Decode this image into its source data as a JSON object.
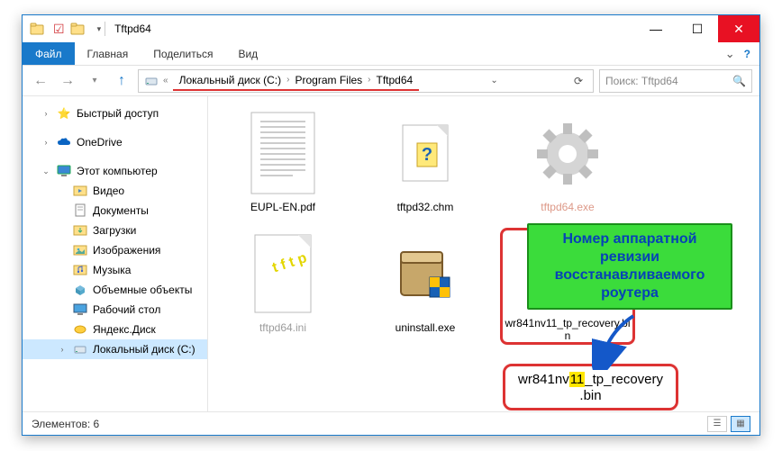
{
  "titlebar": {
    "app_title": "Tftpd64"
  },
  "ribbon": {
    "file": "Файл",
    "home": "Главная",
    "share": "Поделиться",
    "view": "Вид"
  },
  "breadcrumbs": {
    "local_disk": "Локальный диск (C:)",
    "program_files": "Program Files",
    "folder": "Tftpd64"
  },
  "search": {
    "placeholder": "Поиск: Tftpd64"
  },
  "nav": {
    "quick_access": "Быстрый доступ",
    "onedrive": "OneDrive",
    "this_pc": "Этот компьютер",
    "videos": "Видео",
    "documents": "Документы",
    "downloads": "Загрузки",
    "pictures": "Изображения",
    "music": "Музыка",
    "objects3d": "Объемные объекты",
    "desktop": "Рабочий стол",
    "yandex_disk": "Яндекс.Диск",
    "local_c": "Локальный диск (C:)"
  },
  "files": [
    {
      "name": "EUPL-EN.pdf",
      "kind": "pdf"
    },
    {
      "name": "tftpd32.chm",
      "kind": "chm"
    },
    {
      "name": "tftpd64.exe",
      "kind": "exe"
    },
    {
      "name": "tftpd64.ini",
      "kind": "ini"
    },
    {
      "name": "uninstall.exe",
      "kind": "uninst"
    },
    {
      "name": "wr841nv11_tp_recovery.bin",
      "kind": "bin"
    }
  ],
  "statusbar": {
    "elements_label": "Элементов: 6"
  },
  "callout": {
    "text": "Номер аппаратной ревизии восстанавливаемого роутера"
  },
  "enlarged": {
    "pre": "wr841nv",
    "hl": "11",
    "post": "_tp_recovery",
    "line2": ".bin"
  }
}
